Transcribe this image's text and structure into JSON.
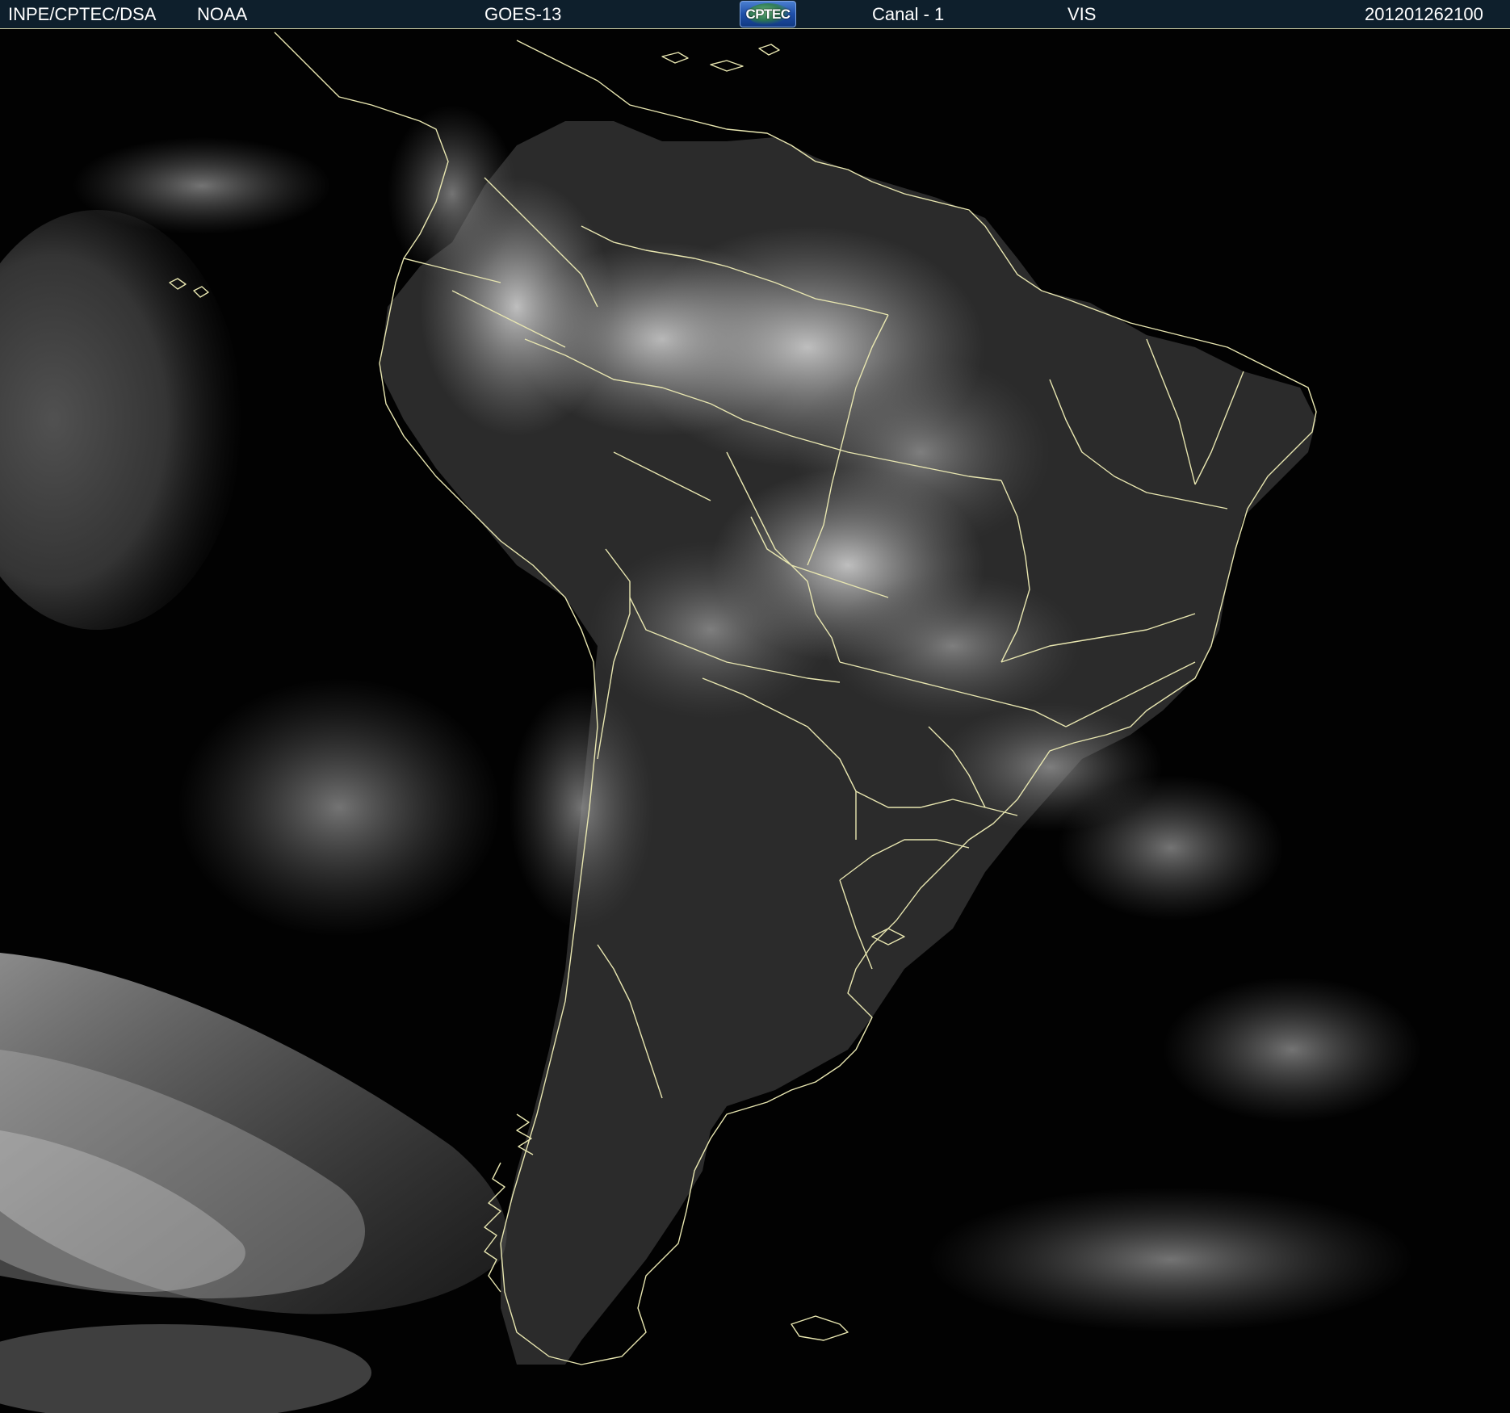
{
  "header": {
    "institution": "INPE/CPTEC/DSA",
    "agency": "NOAA",
    "satellite": "GOES-13",
    "logo_text": "CPTEC",
    "channel": "Canal - 1",
    "band": "VIS",
    "timestamp": "201201262100"
  },
  "map": {
    "region": "South America",
    "colors": {
      "background": "#000000",
      "header_background": "#0e1f2c",
      "header_text": "#ffffff",
      "borders": "#e8e6b0",
      "clouds": "#c8c8c8",
      "ocean_haze": "#3c3c3c"
    }
  }
}
